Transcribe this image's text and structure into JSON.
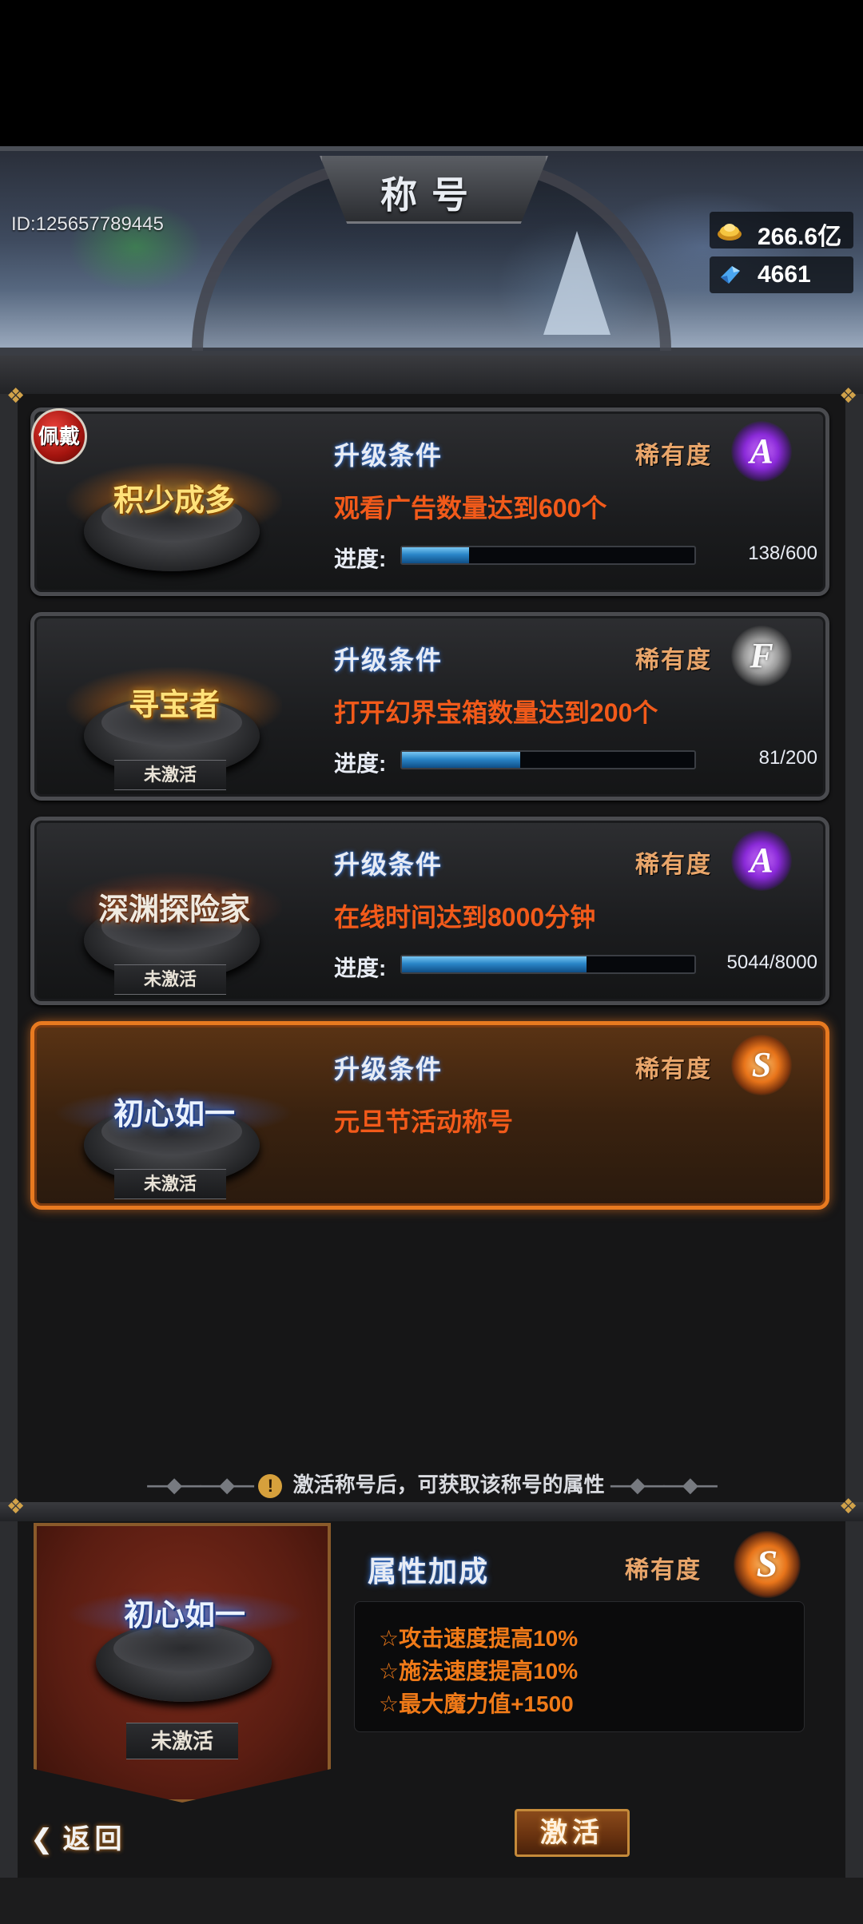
{
  "header": {
    "title": "称号",
    "user_id": "ID:125657789445",
    "gold": "266.6亿",
    "diamonds": "4661"
  },
  "cards": [
    {
      "badge_name": "积少成多",
      "equipped_label": "佩戴",
      "status": "",
      "condition_label": "升级条件",
      "rarity_label": "稀有度",
      "rarity": "A",
      "condition": "观看广告数量达到600个",
      "progress_label": "进度:",
      "progress_current": 138,
      "progress_total": 600,
      "progress_text": "138/600"
    },
    {
      "badge_name": "寻宝者",
      "status": "未激活",
      "condition_label": "升级条件",
      "rarity_label": "稀有度",
      "rarity": "F",
      "condition": "打开幻界宝箱数量达到200个",
      "progress_label": "进度:",
      "progress_current": 81,
      "progress_total": 200,
      "progress_text": "81/200"
    },
    {
      "badge_name": "深渊探险家",
      "status": "未激活",
      "condition_label": "升级条件",
      "rarity_label": "稀有度",
      "rarity": "A",
      "condition": "在线时间达到8000分钟",
      "progress_label": "进度:",
      "progress_current": 5044,
      "progress_total": 8000,
      "progress_text": "5044/8000"
    },
    {
      "badge_name": "初心如一",
      "status": "未激活",
      "condition_label": "升级条件",
      "rarity_label": "稀有度",
      "rarity": "S",
      "condition": "元旦节活动称号",
      "selected": true
    }
  ],
  "hint": "激活称号后，可获取该称号的属性",
  "detail": {
    "badge_name": "初心如一",
    "status": "未激活",
    "bonus_title": "属性加成",
    "rarity_label": "稀有度",
    "rarity": "S",
    "bonuses": [
      "☆攻击速度提高10%",
      "☆施法速度提高10%",
      "☆最大魔力值+1500"
    ]
  },
  "footer": {
    "back_label": "返回",
    "activate_label": "激活"
  },
  "colors": {
    "accent_orange": "#f25a1a",
    "selected_border": "#e87a20",
    "progress_blue": "#2a86c8",
    "rarity_purple": "#8a2ad8",
    "rarity_grey": "#9a9a9a",
    "rarity_orange": "#e8741a"
  },
  "icons": {
    "gold": "gold-ingot-icon",
    "diamond": "blue-gem-icon",
    "hint": "exclamation-icon",
    "back": "chevron-left-icon"
  }
}
